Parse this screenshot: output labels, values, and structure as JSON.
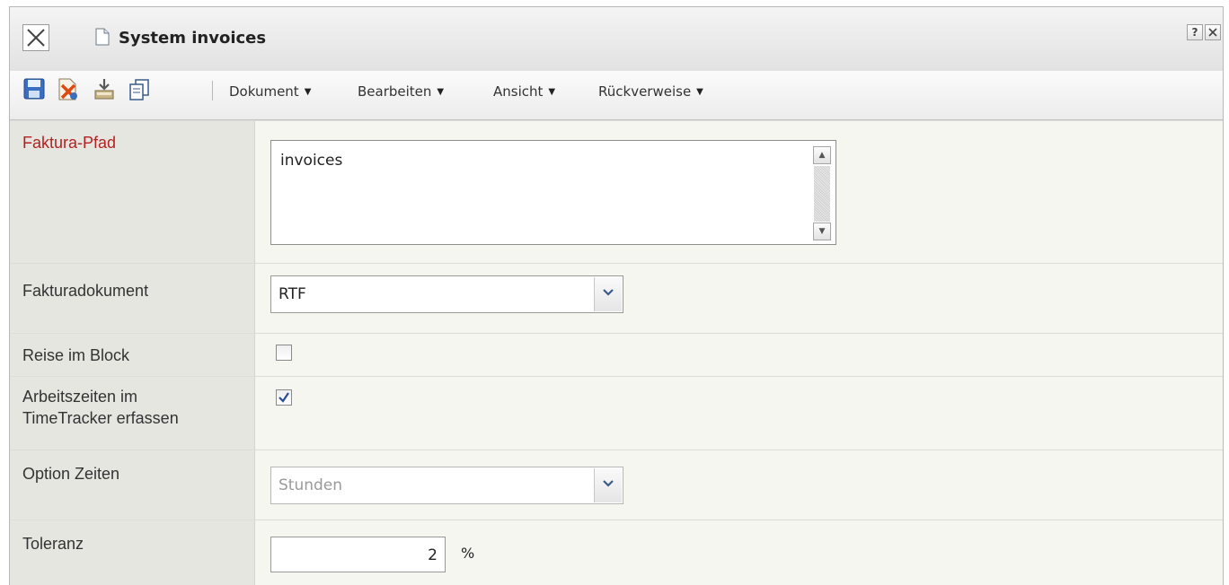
{
  "window": {
    "title": "System invoices",
    "help_label": "?",
    "close_small_label": "X"
  },
  "toolbar": {
    "icons": [
      "save-icon",
      "delete-document-icon",
      "import-icon",
      "copy-icon"
    ],
    "menus": [
      {
        "label": "Dokument"
      },
      {
        "label": "Bearbeiten"
      },
      {
        "label": "Ansicht"
      },
      {
        "label": "Rückverweise"
      }
    ]
  },
  "form": {
    "faktura_pfad": {
      "label": "Faktura-Pfad",
      "value": "invoices",
      "required": true
    },
    "fakturadokument": {
      "label": "Fakturadokument",
      "value": "RTF"
    },
    "reise_im_block": {
      "label": "Reise im Block",
      "checked": false
    },
    "arbeitszeiten": {
      "label_line1": "Arbeitszeiten im",
      "label_line2": "TimeTracker erfassen",
      "checked": true
    },
    "option_zeiten": {
      "label": "Option Zeiten",
      "value": "Stunden",
      "disabled": true
    },
    "toleranz": {
      "label": "Toleranz",
      "value": "2",
      "unit": "%"
    }
  },
  "colors": {
    "required_label": "#b22222",
    "label_background": "#e6e6e0",
    "value_background": "#f6f6f1"
  }
}
